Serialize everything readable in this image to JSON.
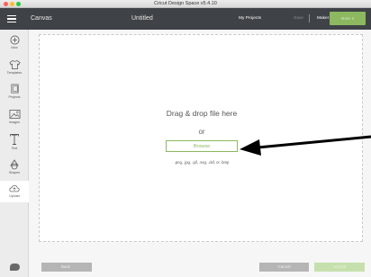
{
  "window": {
    "title": "Cricut Design Space  v5.4.10"
  },
  "header": {
    "app_name": "Canvas",
    "document_title": "Untitled",
    "my_projects": "My Projects",
    "save": "Save",
    "machine": "Maker",
    "make_it": "Make It"
  },
  "sidebar": {
    "items": [
      {
        "label": "New",
        "icon": "plus-circle-icon"
      },
      {
        "label": "Templates",
        "icon": "shirt-icon"
      },
      {
        "label": "Projects",
        "icon": "projects-icon"
      },
      {
        "label": "Images",
        "icon": "image-icon"
      },
      {
        "label": "Text",
        "icon": "text-icon"
      },
      {
        "label": "Shapes",
        "icon": "shapes-icon"
      },
      {
        "label": "Upload",
        "icon": "upload-icon"
      }
    ]
  },
  "dropzone": {
    "heading": "Drag & drop file here",
    "or": "or",
    "browse": "Browse",
    "formats": ".png, .jpg, .gif, .svg, .dxf, or .bmp"
  },
  "footer": {
    "back": "Back",
    "cancel": "Cancel",
    "upload": "Upload"
  },
  "colors": {
    "header_bg": "#3f4246",
    "accent_green": "#8cb85f",
    "sidebar_bg": "#ececec"
  }
}
